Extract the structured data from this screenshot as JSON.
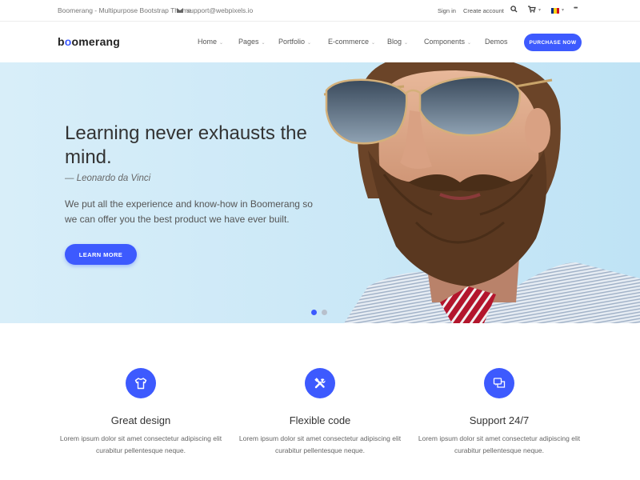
{
  "topbar": {
    "tagline": "Boomerang - Multipurpose Bootstrap Theme",
    "support_email": "support@webpixels.io",
    "sign_in": "Sign in",
    "create_account": "Create account",
    "more": "•••"
  },
  "nav": {
    "logo": "boomerang",
    "items": [
      {
        "label": "Home",
        "has_dropdown": true
      },
      {
        "label": "Pages",
        "has_dropdown": true
      },
      {
        "label": "Portfolio",
        "has_dropdown": true
      },
      {
        "label": "E-commerce",
        "has_dropdown": true
      },
      {
        "label": "Blog",
        "has_dropdown": true
      },
      {
        "label": "Components",
        "has_dropdown": true
      },
      {
        "label": "Demos",
        "has_dropdown": false
      }
    ],
    "cta": "PURCHASE NOW"
  },
  "hero": {
    "title": "Learning never exhausts the mind.",
    "quote_author": "— Leonardo da Vinci",
    "text": "We put all the experience and know-how in Boomerang so we can offer you the best product we have ever built.",
    "button": "LEARN MORE",
    "slides_total": 2,
    "active_slide": 1
  },
  "features": [
    {
      "icon": "tshirt-icon",
      "title": "Great design",
      "text": "Lorem ipsum dolor sit amet consectetur adipiscing elit curabitur pellentesque neque."
    },
    {
      "icon": "tools-icon",
      "title": "Flexible code",
      "text": "Lorem ipsum dolor sit amet consectetur adipiscing elit curabitur pellentesque neque."
    },
    {
      "icon": "chat-icon",
      "title": "Support 24/7",
      "text": "Lorem ipsum dolor sit amet consectetur adipiscing elit curabitur pellentesque neque."
    }
  ],
  "colors": {
    "accent": "#3d5afe",
    "hero_background": "#cde9f7",
    "text": "#333333"
  }
}
